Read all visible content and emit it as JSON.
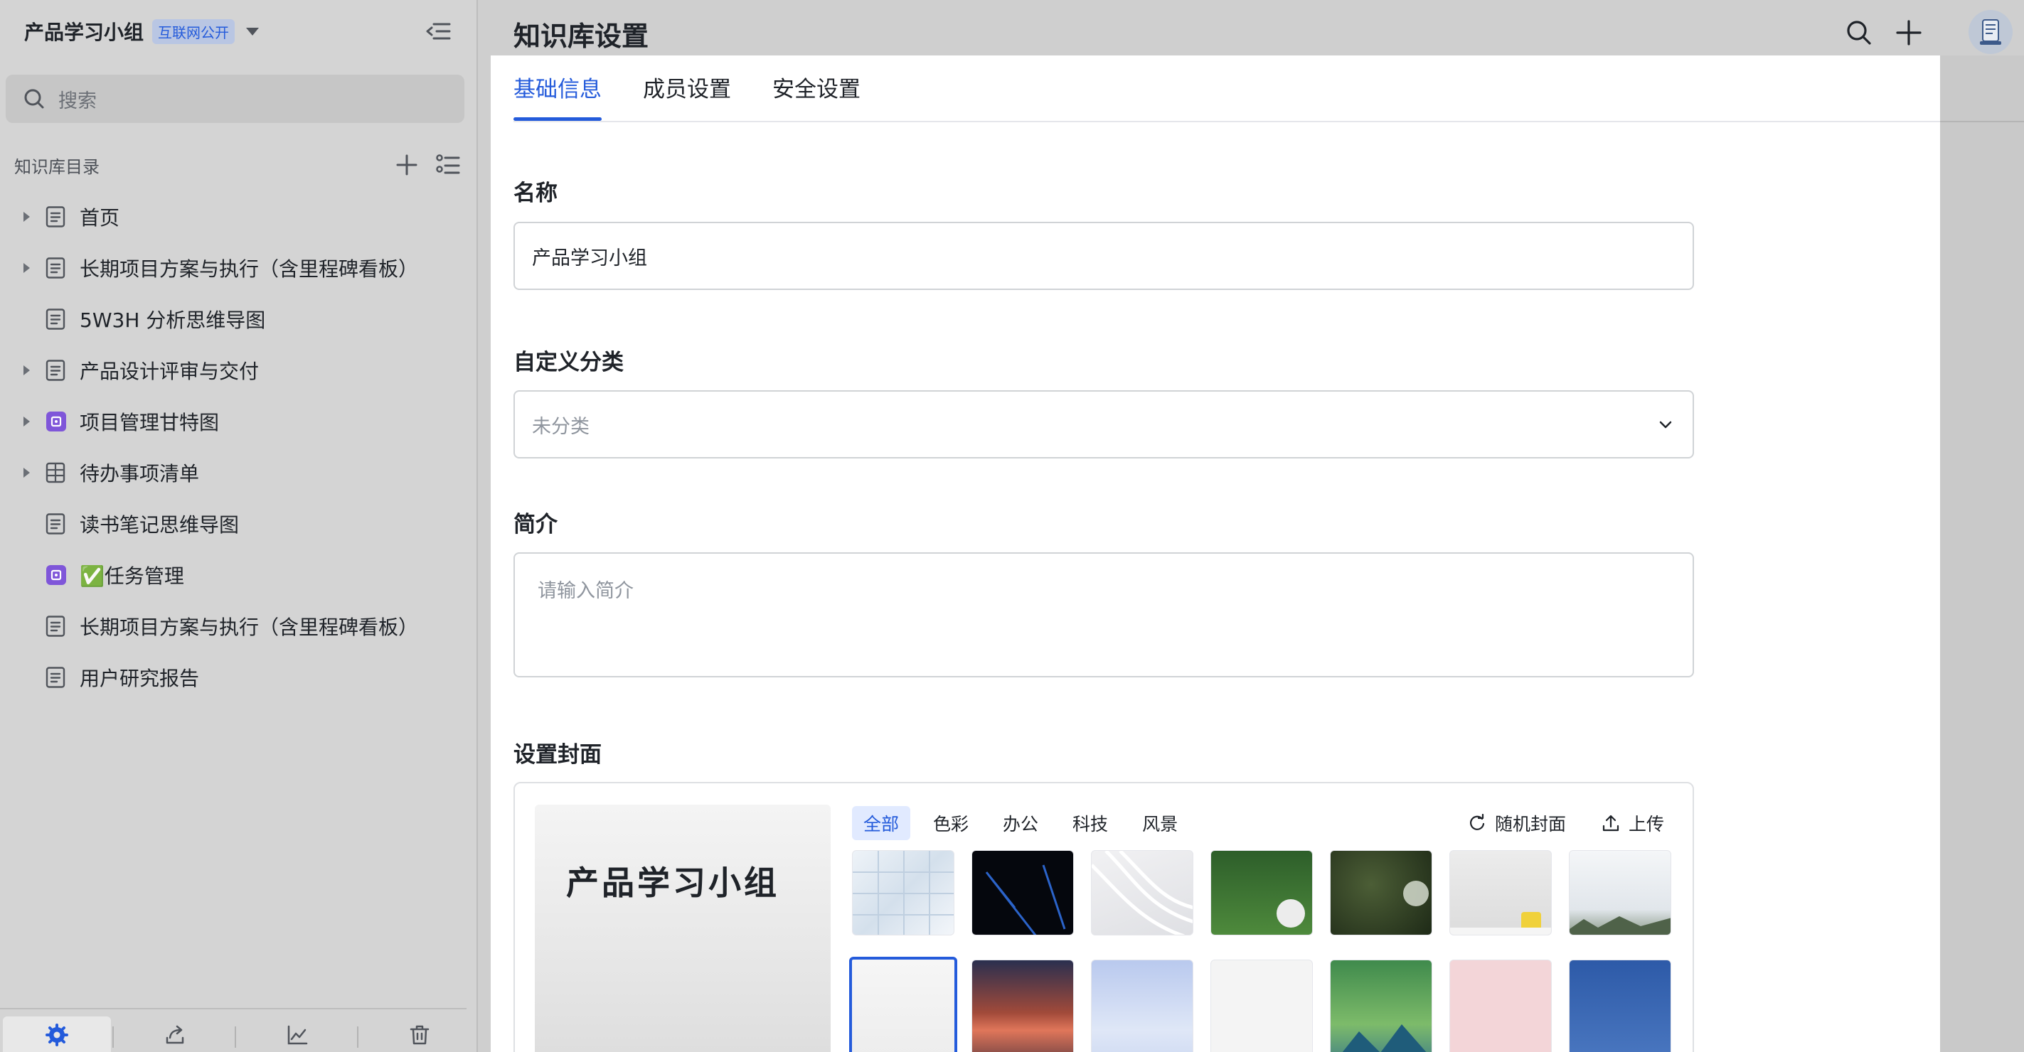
{
  "sidebar": {
    "title": "产品学习小组",
    "badge": "互联网公开",
    "search_placeholder": "搜索",
    "directory_label": "知识库目录",
    "items": [
      {
        "label": "首页",
        "has_children": true,
        "icon": "doc-icon"
      },
      {
        "label": "长期项目方案与执行（含里程碑看板）",
        "has_children": true,
        "icon": "doc-icon"
      },
      {
        "label": "5W3H 分析思维导图",
        "has_children": false,
        "icon": "doc-icon"
      },
      {
        "label": "产品设计评审与交付",
        "has_children": true,
        "icon": "doc-icon"
      },
      {
        "label": "项目管理甘特图",
        "has_children": true,
        "icon": "app-icon"
      },
      {
        "label": "待办事项清单",
        "has_children": true,
        "icon": "table-icon"
      },
      {
        "label": "读书笔记思维导图",
        "has_children": false,
        "icon": "doc-icon"
      },
      {
        "label": "✅任务管理",
        "has_children": false,
        "icon": "app-icon"
      },
      {
        "label": "长期项目方案与执行（含里程碑看板）",
        "has_children": false,
        "icon": "doc-icon"
      },
      {
        "label": "用户研究报告",
        "has_children": false,
        "icon": "doc-icon"
      }
    ]
  },
  "header": {
    "title": "知识库设置"
  },
  "tabs": [
    {
      "label": "基础信息",
      "active": true
    },
    {
      "label": "成员设置",
      "active": false
    },
    {
      "label": "安全设置",
      "active": false
    }
  ],
  "form": {
    "name_label": "名称",
    "name_value": "产品学习小组",
    "category_label": "自定义分类",
    "category_value": "未分类",
    "intro_label": "简介",
    "intro_placeholder": "请输入简介",
    "cover_label": "设置封面"
  },
  "cover": {
    "preview_title": "产品学习小组",
    "categories": [
      {
        "label": "全部",
        "active": true
      },
      {
        "label": "色彩",
        "active": false
      },
      {
        "label": "办公",
        "active": false
      },
      {
        "label": "科技",
        "active": false
      },
      {
        "label": "风景",
        "active": false
      }
    ],
    "random_label": "随机封面",
    "upload_label": "上传"
  },
  "colors": {
    "accent": "#245bdb",
    "sidebar_bg": "#d4d4d4"
  }
}
